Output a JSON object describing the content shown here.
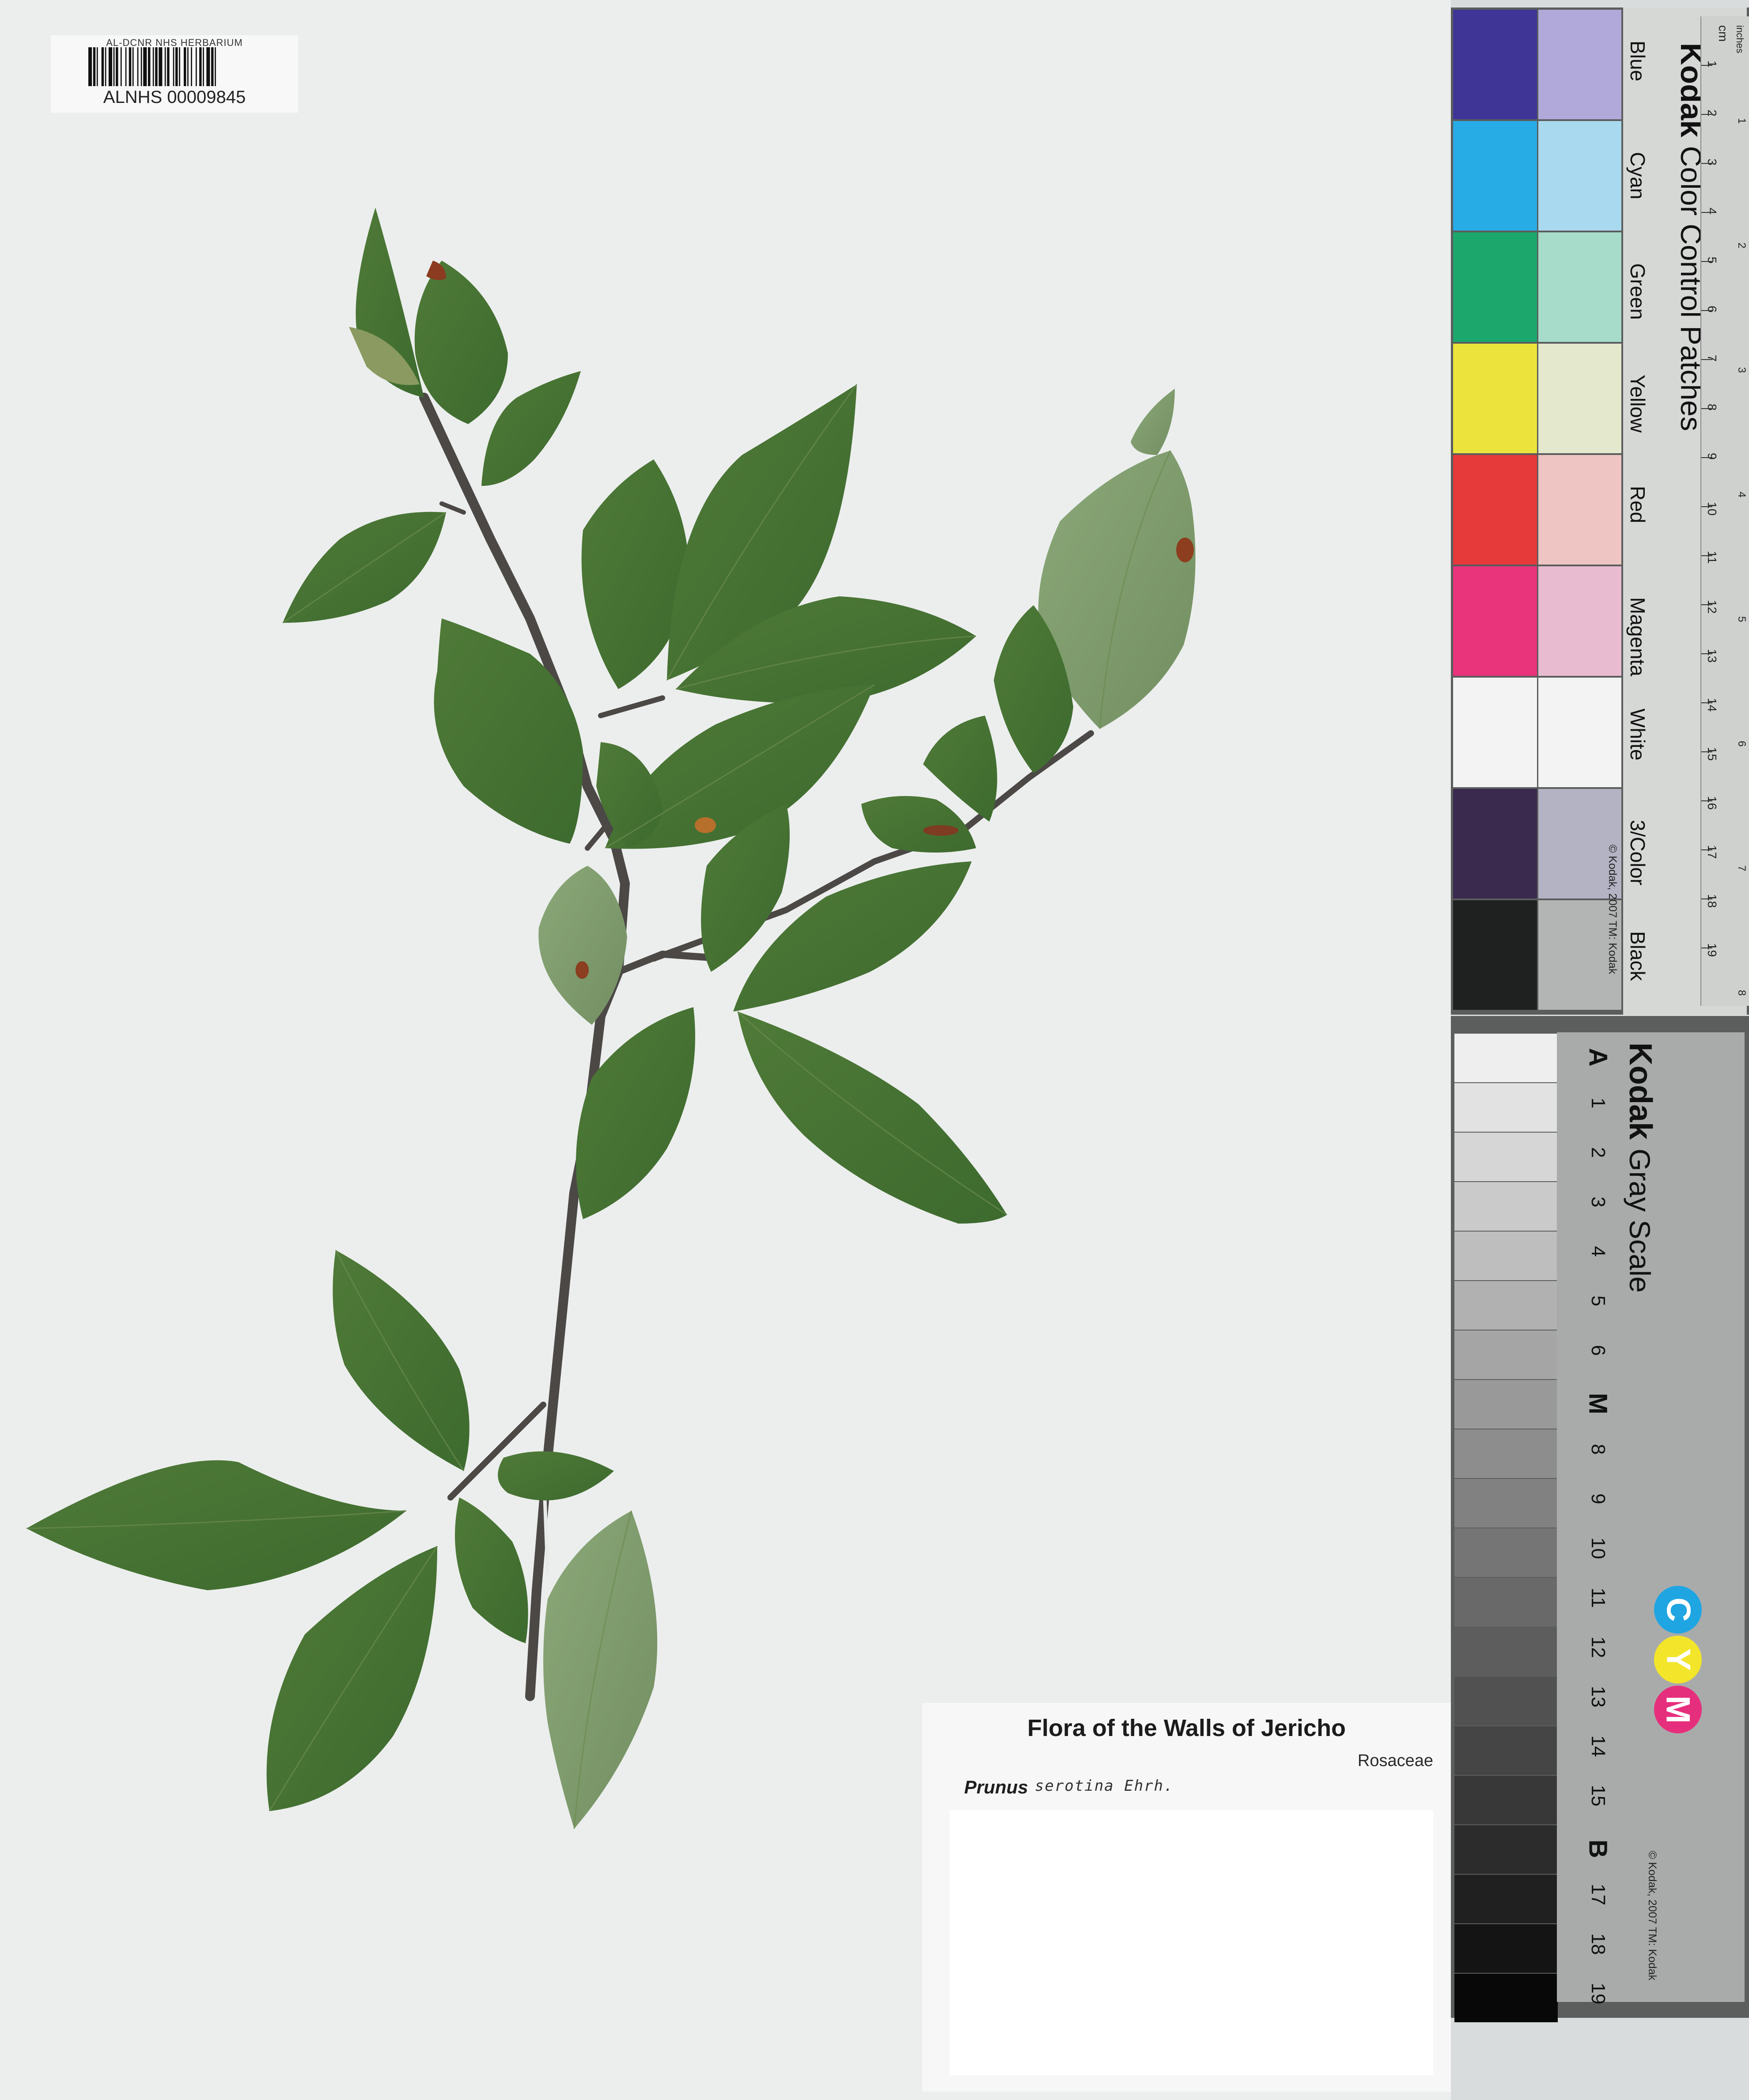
{
  "barcode": {
    "institution": "AL-DCNR NHS HERBARIUM",
    "number": "ALNHS 00009845"
  },
  "label": {
    "title": "Flora of the Walls of Jericho",
    "family": "Rosaceae",
    "genus": "Prunus",
    "epithet_handwritten": "serotina Ehrh."
  },
  "color_checker": {
    "brand": "Kodak",
    "title": "Color Control Patches",
    "copyright": "© Kodak, 2007 TM: Kodak",
    "ruler_cm_label": "cm",
    "ruler_inch_label": "inches",
    "ruler_cm": [
      "1",
      "2",
      "3",
      "4",
      "5",
      "6",
      "7",
      "8",
      "9",
      "10",
      "11",
      "12",
      "13",
      "14",
      "15",
      "16",
      "17",
      "18",
      "19"
    ],
    "ruler_inch": [
      "1",
      "2",
      "3",
      "4",
      "5",
      "6",
      "7",
      "8"
    ],
    "patches": [
      {
        "name": "Blue",
        "dark": "#3f3596",
        "light": "#b0a9d9"
      },
      {
        "name": "Cyan",
        "dark": "#28ace6",
        "light": "#a9d9ee"
      },
      {
        "name": "Green",
        "dark": "#1ca86d",
        "light": "#a6dcc9"
      },
      {
        "name": "Yellow",
        "dark": "#ece43c",
        "light": "#e4e9ce"
      },
      {
        "name": "Red",
        "dark": "#e5393a",
        "light": "#eec5c2"
      },
      {
        "name": "Magenta",
        "dark": "#e9337b",
        "light": "#e9bbd0"
      },
      {
        "name": "White",
        "dark": "#f2f3f2",
        "light": "#f2f3f2"
      },
      {
        "name": "3/Color",
        "dark": "#3a2a4e",
        "light": "#b4b3c3"
      },
      {
        "name": "Black",
        "dark": "#1f2121",
        "light": "#b3b5b4"
      }
    ]
  },
  "gray_scale": {
    "brand": "Kodak",
    "title": "Gray Scale",
    "copyright": "© Kodak, 2007 TM: Kodak",
    "steps": [
      "A",
      "1",
      "2",
      "3",
      "4",
      "5",
      "6",
      "M",
      "8",
      "9",
      "10",
      "11",
      "12",
      "13",
      "14",
      "15",
      "B",
      "17",
      "18",
      "19"
    ],
    "cym": [
      "C",
      "Y",
      "M"
    ],
    "cym_colors": [
      "#1fa5e2",
      "#f3e52a",
      "#e62f7c"
    ]
  }
}
